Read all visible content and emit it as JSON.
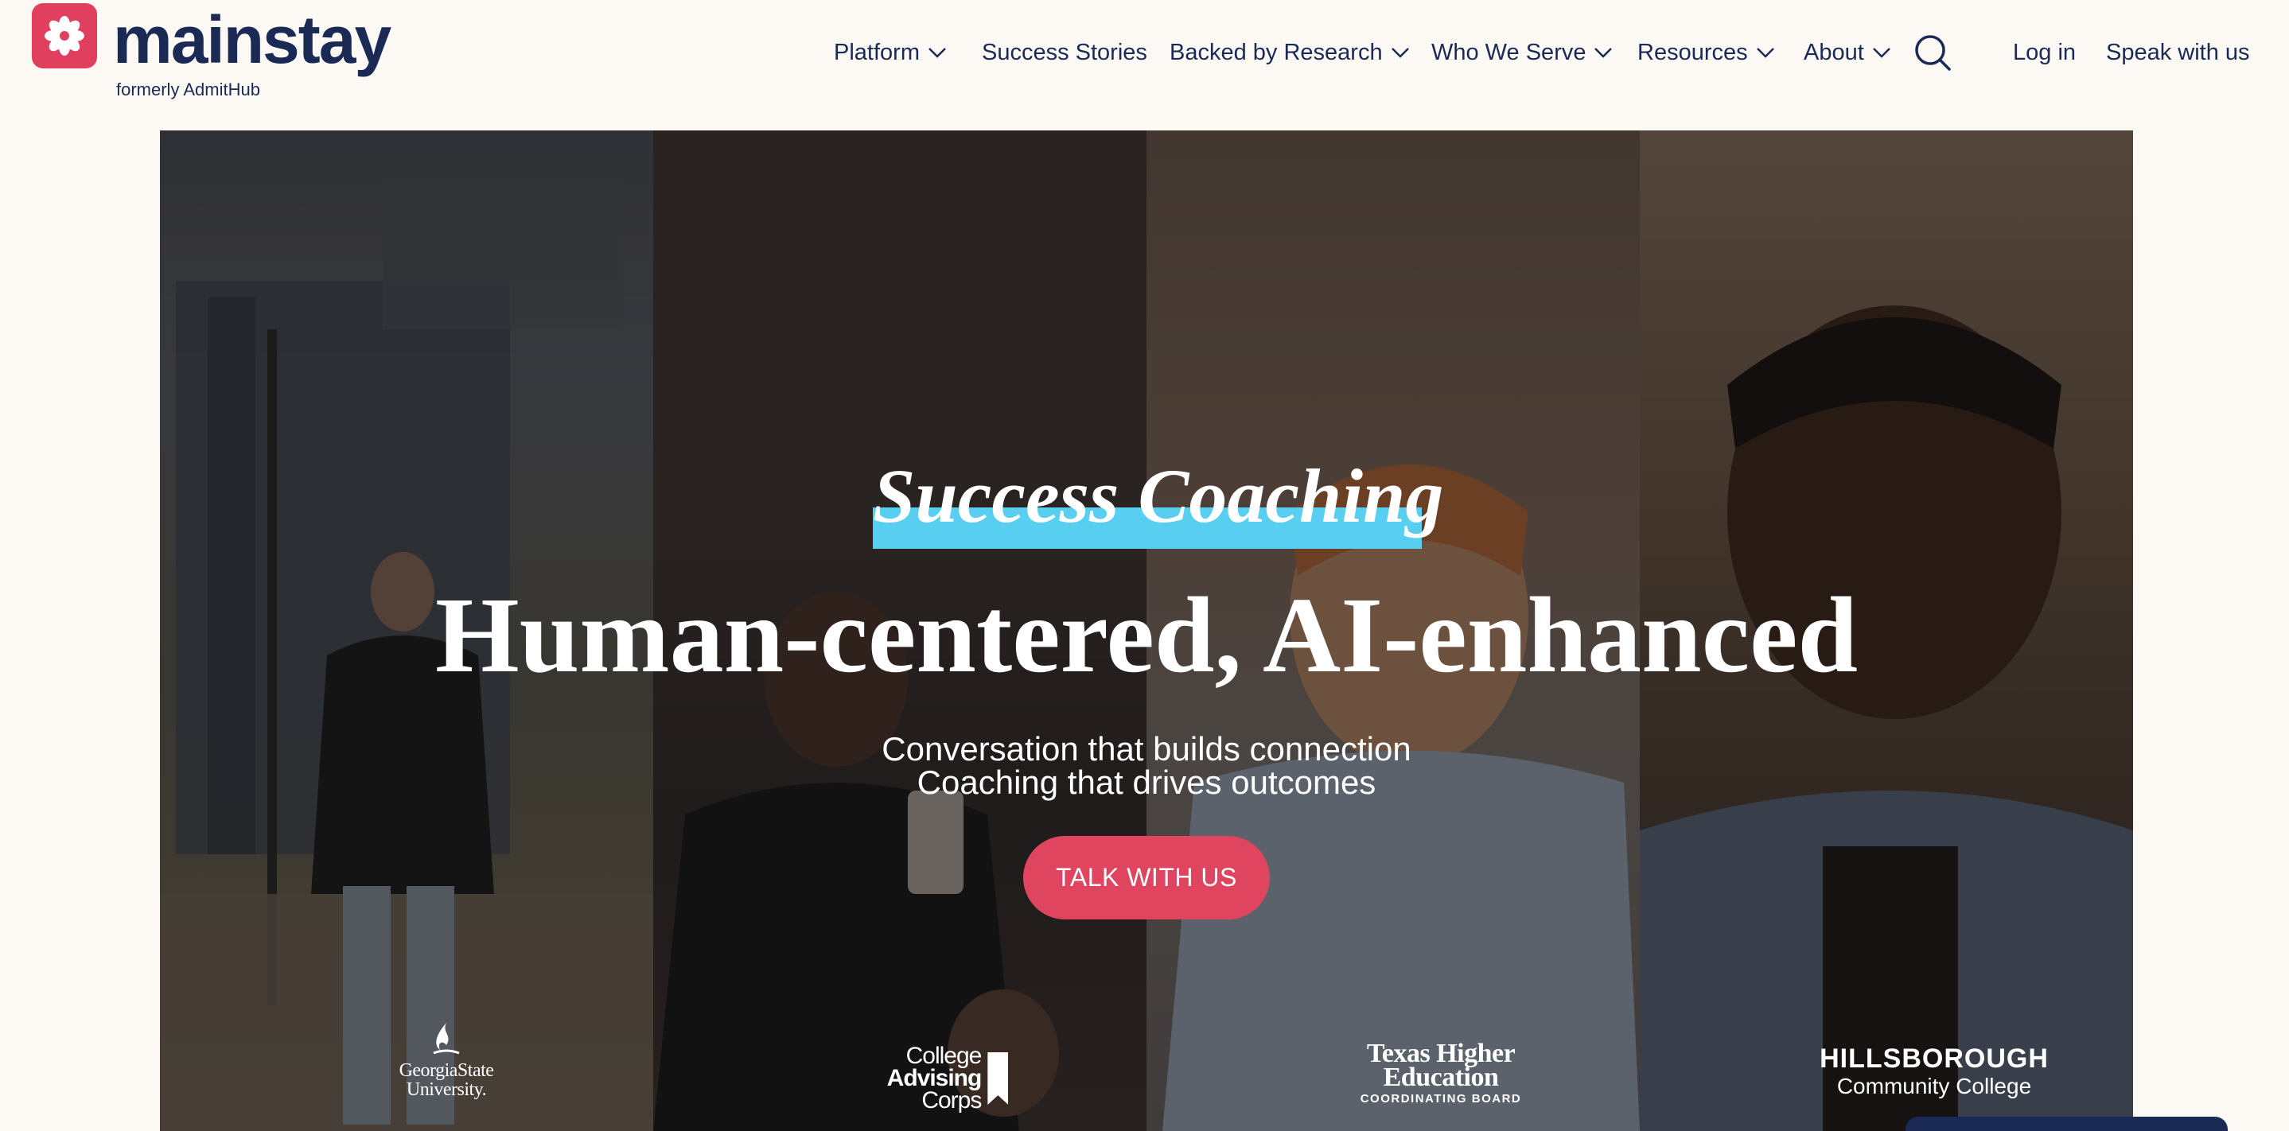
{
  "brand": {
    "name": "mainstay",
    "tagline": "formerly AdmitHub",
    "color": "#e0405e"
  },
  "nav": {
    "items": [
      {
        "label": "Platform",
        "has_dropdown": true
      },
      {
        "label": "Success Stories",
        "has_dropdown": false
      },
      {
        "label": "Backed by Research",
        "has_dropdown": true
      },
      {
        "label": "Who We Serve",
        "has_dropdown": true
      },
      {
        "label": "Resources",
        "has_dropdown": true
      },
      {
        "label": "About",
        "has_dropdown": true
      }
    ],
    "search_icon": "search-icon",
    "login_label": "Log in",
    "contact_label": "Speak with us"
  },
  "hero": {
    "eyebrow": "Success Coaching",
    "headline": "Human-centered, AI-enhanced",
    "subline_1": "Conversation that builds connection",
    "subline_2": "Coaching that drives outcomes",
    "cta_label": "TALK WITH US",
    "accent_color": "#58cff0",
    "cta_color": "#e0455f"
  },
  "client_logos": {
    "gsu": {
      "line1": "GeorgiaState",
      "line2": "University."
    },
    "cac": {
      "line1": "College",
      "line2": "Advising",
      "line3": "Corps"
    },
    "thecb": {
      "line1": "Texas Higher",
      "line2": "Education",
      "line3": "COORDINATING BOARD"
    },
    "hcc": {
      "line1": "HILLSBOROUGH",
      "line2": "Community College"
    }
  }
}
